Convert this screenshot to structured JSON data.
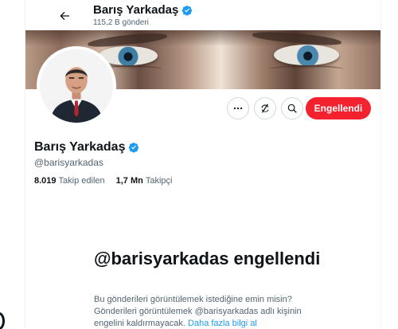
{
  "header": {
    "name": "Barış Yarkadaş",
    "posts_count": "115,2 B gönderi"
  },
  "profile": {
    "name": "Barış Yarkadaş",
    "handle": "@barisyarkadas",
    "following_count": "8.019",
    "following_label": "Takip edilen",
    "followers_count": "1,7 Mn",
    "followers_label": "Takipçi",
    "verified": true
  },
  "actions": {
    "more_icon": "more-icon",
    "subscribe_icon": "notification-off-icon",
    "search_icon": "search-icon",
    "blocked_label": "Engellendi"
  },
  "blocked_notice": {
    "title": "@barisyarkadas engellendi",
    "body_text": "Bu gönderileri görüntülemek istediğine emin misin? Gönderileri görüntülemek @barisyarkadas adlı kişinin engelini kaldırmayacak.",
    "link_text": "Daha fazla bilgi al"
  },
  "colors": {
    "accent_blue": "#1d9bf0",
    "blocked_red": "#f4212e",
    "muted_text": "#536471",
    "text": "#0f1419"
  }
}
